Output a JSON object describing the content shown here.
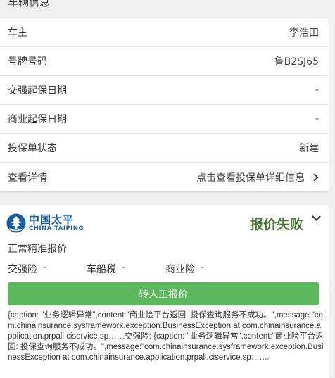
{
  "vehicle_info": {
    "section_title": "车辆信息",
    "rows": [
      {
        "label": "车主",
        "value": "李浩田"
      },
      {
        "label": "号牌号码",
        "value": "鲁B2SJ65"
      },
      {
        "label": "交强起保日期",
        "value": "-"
      },
      {
        "label": "商业起保日期",
        "value": "-"
      },
      {
        "label": "投保单状态",
        "value": "新建"
      },
      {
        "label": "查看详情",
        "value": "点击查看投保单详细信息"
      }
    ]
  },
  "quote": {
    "insurer_logo_cn": "中国太平",
    "insurer_logo_en": "CHINA TAIPING",
    "status": "报价失败",
    "quote_type": "正常精准报价",
    "fees": [
      {
        "label": "交强险",
        "value": "-"
      },
      {
        "label": "车船税",
        "value": "-"
      },
      {
        "label": "商业险",
        "value": "-"
      }
    ],
    "manual_button": "转人工报价",
    "error_message": "{caption: \"业务逻辑异常\",content:\"商业险平台返回: 投保查询服务不成功。\",message:\"com.chinainsurance.sysframework.exception.BusinessException at com.chinainsurance.application.prpall.ciservice.sp……交强险: {caption: \"业务逻辑异常\",content:\"商业险平台返回: 投保查询服务不成功。\",message:\"com.chinainsurance.sysframework.exception.BusinessException at com.chinainsurance.application.prpall.ciservice.sp……。"
  },
  "colors": {
    "brand_blue": "#1a5ea8",
    "status_fail": "#4a7a3a",
    "button_green": "#5cb85c"
  }
}
